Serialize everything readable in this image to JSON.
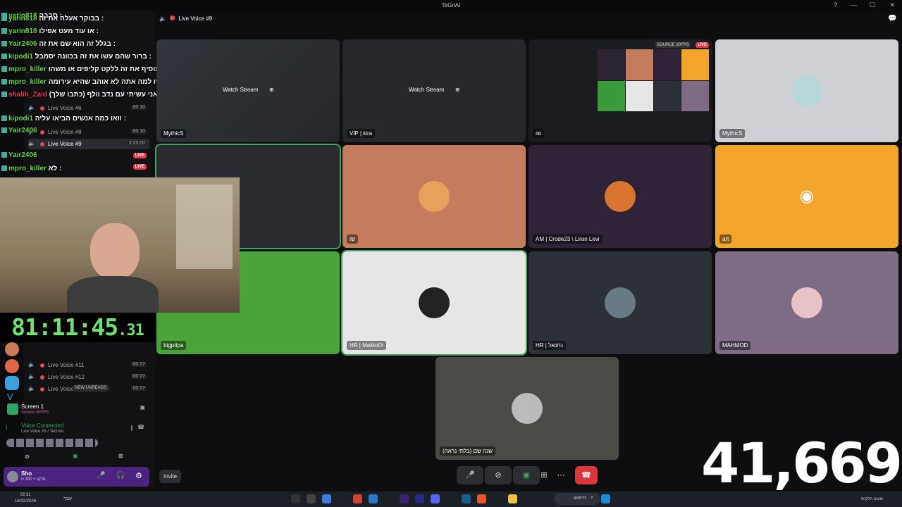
{
  "window": {
    "title": "TeGriAI"
  },
  "header": {
    "channel": "Live Voice #9"
  },
  "chat": [
    {
      "user": "yarin818",
      "text": "סבבה :"
    },
    {
      "user": "yarin818",
      "text": "בבוקר אעלה את זה :"
    },
    {
      "user": "yarin818",
      "text": "או עוד מעט אפילו :"
    },
    {
      "user": "Yair2406",
      "text": "בגלל זה הוא שם את זה :"
    },
    {
      "user": "kipodi1",
      "text": "ברור שהם עשו את זה בכוונה יסמבל :"
    },
    {
      "user": "mpro_killer",
      "text": "פשוט תוסיף את זה ללקט קליפים או משהו :"
    },
    {
      "user": "mpro_killer",
      "text": "שו למה אתה לא אוהב שהיא עירומה ? :"
    },
    {
      "user": "shalih_Zaid",
      "text": "שו אתה רוצה לשמוע שיר שאני עשיתי עם נדב וולף (כתבו שלך) :"
    },
    {
      "user": "kipodi1",
      "text": "וואו כמה אנשים הביאו עליה :"
    },
    {
      "user": "Yair2406",
      "text": ""
    },
    {
      "user": "Yair2406",
      "text": ""
    },
    {
      "user": "mpro_killer",
      "text": "לא :"
    }
  ],
  "sidebar": {
    "channels_top": [
      {
        "name": "Live Voice #6",
        "count": "00 10"
      },
      {
        "name": "Live Voice #8",
        "count": "00 10"
      },
      {
        "name": "Live Voice #9",
        "count": "3:25:00"
      }
    ],
    "channels_bottom": [
      {
        "name": "Live Voice #11",
        "count": "00 07"
      },
      {
        "name": "Live Voice #12",
        "count": "00 07"
      },
      {
        "name": "Live Voice",
        "count": "00 07"
      }
    ],
    "new_unreads": "NEW UNREADS",
    "live_label": "LIVE",
    "screen": {
      "title": "Screen 1",
      "sub": "Source 30FPS"
    },
    "voice": {
      "status": "Voice Connected",
      "sub": "Live Voice #9 / TeGriAI"
    },
    "user": {
      "name": "Sho",
      "status": "סלקו + 300 ס"
    }
  },
  "timer": {
    "main": "81:11:45",
    "frac": ".31"
  },
  "grid": {
    "watch_label": "Watch Stream",
    "source_badge": "SOURCE 30FPS",
    "live_badge": "LIVE",
    "tiles": [
      {
        "label": "MythicS"
      },
      {
        "label": "VIP | kira"
      },
      {
        "label": "שו"
      },
      {
        "label": "MythicS"
      },
      {
        "label": ""
      },
      {
        "label": "שו"
      },
      {
        "label": "AM | Crode23 \\ Liran Levi"
      },
      {
        "label": "art"
      },
      {
        "label": "bigp4pa"
      },
      {
        "label": "HR | MaMoDi"
      },
      {
        "label": "HR | נתנאל"
      },
      {
        "label": "MAHMOD"
      },
      {
        "label": "שנה שם (בלתי נראה)"
      }
    ]
  },
  "invite": "Invite",
  "overlay_count": "41,669",
  "taskbar": {
    "time": "02:31",
    "date": "16/02/2026",
    "search": "חיפוש",
    "lang": "עבר",
    "weather": "מעונן חלקית"
  },
  "colors": {
    "accent": "#5865f2",
    "live": "#e8354a",
    "speaking": "#3ba55d",
    "timer": "#6fe16e"
  }
}
